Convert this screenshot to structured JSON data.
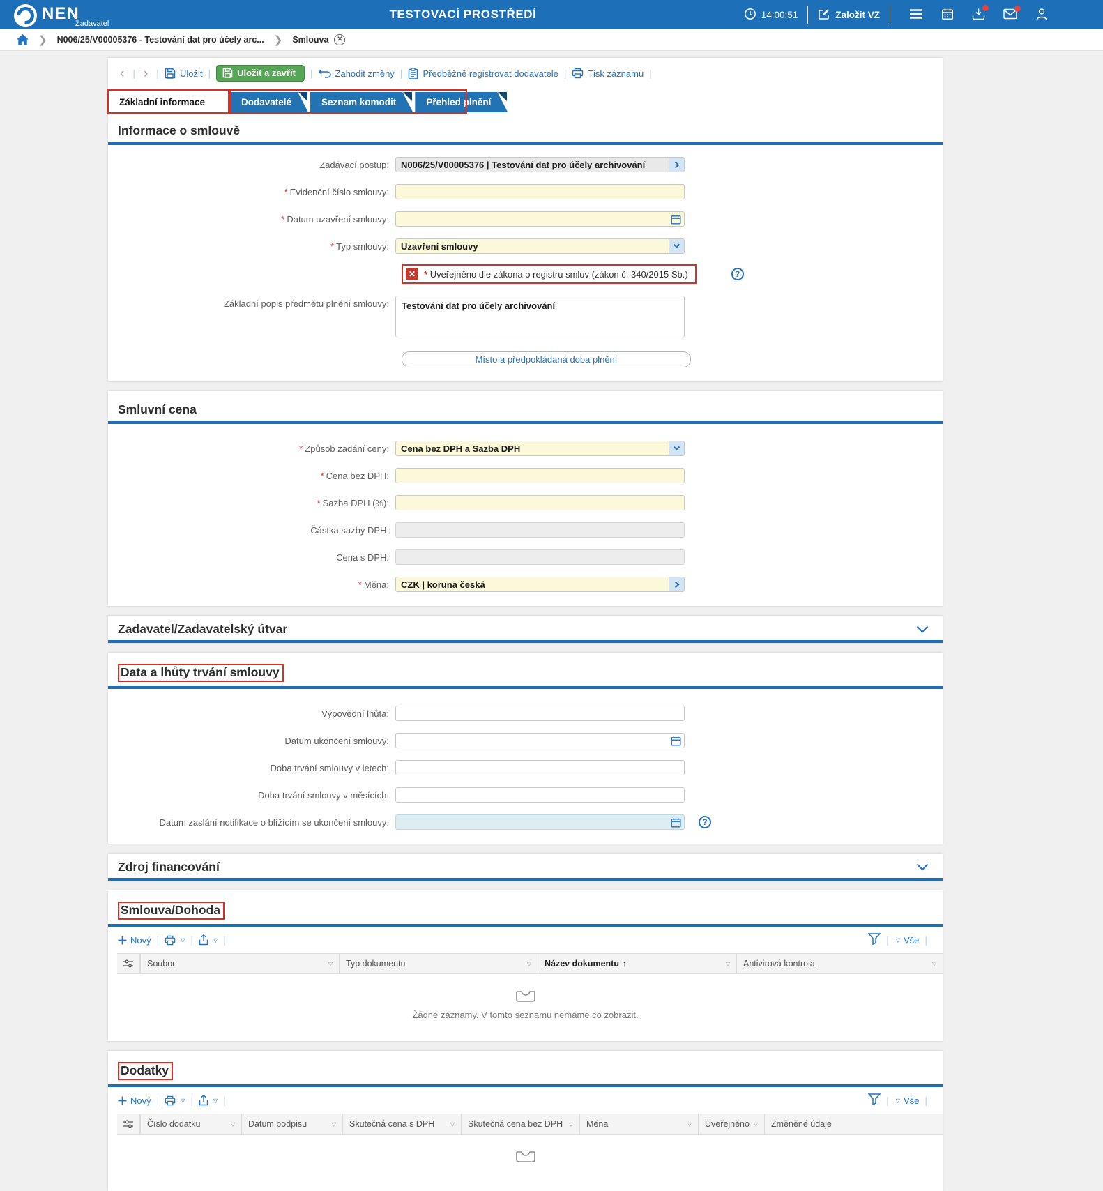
{
  "ui": {
    "star": "*"
  },
  "header": {
    "brand": "NEN",
    "brand_sub": "Zadavatel",
    "env_title": "TESTOVACÍ PROSTŘEDÍ",
    "time": "14:00:51",
    "new_vz": "Založit VZ"
  },
  "breadcrumb": {
    "procedure": "N006/25/V00005376 - Testování dat pro účely arc...",
    "current": "Smlouva"
  },
  "toolbar": {
    "save": "Uložit",
    "save_close": "Uložit a zavřít",
    "discard": "Zahodit změny",
    "preregister": "Předběžně registrovat dodavatele",
    "print": "Tisk záznamu"
  },
  "tabs": [
    {
      "label": "Základní informace"
    },
    {
      "label": "Dodavatelé"
    },
    {
      "label": "Seznam komodit"
    },
    {
      "label": "Přehled plnění"
    }
  ],
  "info": {
    "title": "Informace o smlouvě",
    "zadavaci_postup_label": "Zadávací postup:",
    "zadavaci_postup_value": "N006/25/V00005376 | Testování dat pro účely archivování",
    "evidencni_label": "Evidenční číslo smlouvy:",
    "datum_uzavreni_label": "Datum uzavření smlouvy:",
    "typ_label": "Typ smlouvy:",
    "typ_value": "Uzavření smlouvy",
    "error_text": "Uveřejněno dle zákona o registru smluv (zákon č. 340/2015 Sb.)",
    "popis_label": "Základní popis předmětu plnění smlouvy:",
    "popis_value": "Testování dat pro účely archivování",
    "misto_button": "Místo a předpokládaná doba plnění"
  },
  "cena": {
    "title": "Smluvní cena",
    "zpusob_label": "Způsob zadání ceny:",
    "zpusob_value": "Cena bez DPH a Sazba DPH",
    "cena_bez_label": "Cena bez DPH:",
    "sazba_label": "Sazba DPH (%):",
    "castka_label": "Částka sazby DPH:",
    "cena_s_label": "Cena s DPH:",
    "mena_label": "Měna:",
    "mena_value": "CZK | koruna česká"
  },
  "zadavatel_section": {
    "title": "Zadavatel/Zadavatelský útvar"
  },
  "lhuty": {
    "title": "Data a lhůty trvání smlouvy",
    "vypovedni_label": "Výpovědní lhůta:",
    "ukonceni_label": "Datum ukončení smlouvy:",
    "letech_label": "Doba trvání smlouvy v letech:",
    "mesicich_label": "Doba trvání smlouvy v měsících:",
    "notifikace_label": "Datum zaslání notifikace o blížícím se ukončení smlouvy:"
  },
  "zdroj": {
    "title": "Zdroj financování"
  },
  "smlouva_dohoda": {
    "title": "Smlouva/Dohoda",
    "new": "Nový",
    "all": "Vše",
    "columns": [
      "Soubor",
      "Typ dokumentu",
      "Název dokumentu",
      "Antivirová kontrola"
    ],
    "empty": "Žádné záznamy. V tomto seznamu nemáme co zobrazit."
  },
  "dodatky": {
    "title": "Dodatky",
    "new": "Nový",
    "all": "Vše",
    "columns": [
      "Číslo dodatku",
      "Datum podpisu",
      "Skutečná cena s DPH",
      "Skutečná cena bez DPH",
      "Měna",
      "Uveřejněno",
      "Změněné údaje"
    ]
  }
}
